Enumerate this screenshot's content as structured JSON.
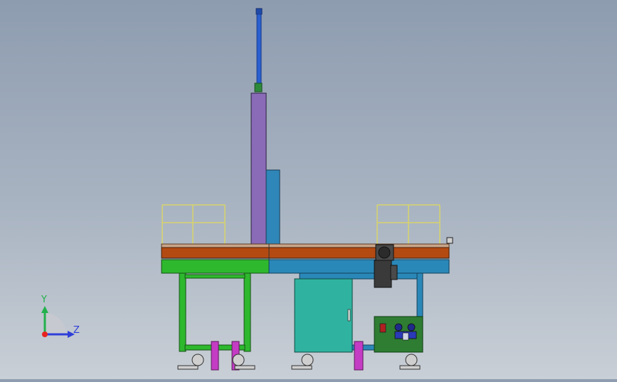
{
  "viewport": {
    "background_top": "#8e9cb0",
    "background_bottom": "#c9cfd6"
  },
  "triad": {
    "y_label": "Y",
    "z_label": "Z",
    "y_color": "#22b14c",
    "z_color": "#2f3fd8",
    "origin_color": "#e8231f"
  },
  "colors": {
    "lift_rod": "#2a5fd0",
    "lift_column": "#8a6bb8",
    "side_column": "#2f86b8",
    "conveyor_top": "#b34a12",
    "frame_green": "#2eb82e",
    "frame_blue": "#2a88b8",
    "cabinet": "#2fb3a0",
    "control_panel": "#2e7d32",
    "guardrail": "#d8d46a",
    "motor": "#3a3a3a",
    "leg_pad": "#c43cc4"
  }
}
